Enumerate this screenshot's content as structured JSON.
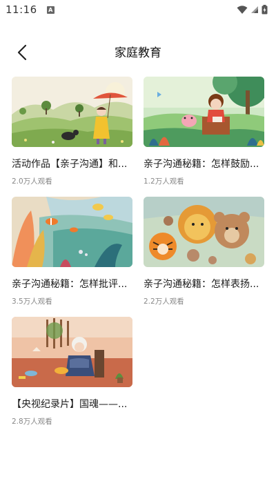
{
  "status": {
    "time": "11:16",
    "notif_icon": "A"
  },
  "header": {
    "title": "家庭教育",
    "back_icon": "chevron-left-icon"
  },
  "videos": [
    {
      "title": "活动作品【亲子沟通】和...",
      "views": "2.0万人观看"
    },
    {
      "title": "亲子沟通秘籍：怎样鼓励...",
      "views": "1.2万人观看"
    },
    {
      "title": "亲子沟通秘籍：怎样批评...",
      "views": "3.5万人观看"
    },
    {
      "title": "亲子沟通秘籍：怎样表扬...",
      "views": "2.2万人观看"
    },
    {
      "title": "【央视纪录片】国魂——...",
      "views": "2.8万人观看"
    }
  ],
  "colors": {
    "text_primary": "#1a1a1a",
    "text_secondary": "#888888",
    "background": "#ffffff"
  }
}
